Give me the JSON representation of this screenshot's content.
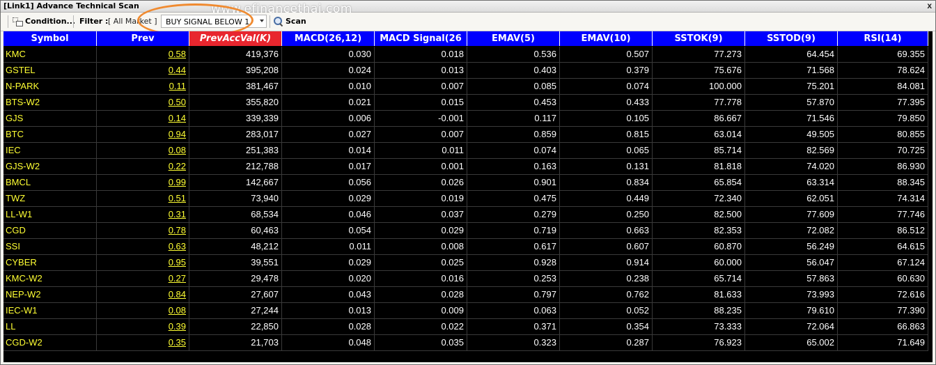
{
  "window": {
    "title": "[Link1] Advance Technical Scan",
    "close_label": "x",
    "watermark": "www.efinancethai.com"
  },
  "toolbar": {
    "condition_label": "Condition...",
    "filter_label": "Filter :",
    "filter_value": "[ All Market ]",
    "signal_selected": "BUY SIGNAL BELOW 1",
    "scan_label": "Scan",
    "highlight_color": "#f08a2f"
  },
  "table": {
    "headers": [
      "Symbol",
      "Prev",
      "PrevAccVal(K)",
      "MACD(26,12)",
      "MACD Signal(26",
      "EMAV(5)",
      "EMAV(10)",
      "SSTOK(9)",
      "SSTOD(9)",
      "RSI(14)"
    ],
    "sorted_column": 2,
    "colors": {
      "header_bg": "#0000ff",
      "sorted_header_bg": "#e8262e",
      "symbol_color": "#ffff33",
      "value_color": "#ffffff",
      "grid_bg": "#000000"
    },
    "rows": [
      [
        "KMC",
        "0.58",
        "419,376",
        "0.030",
        "0.018",
        "0.536",
        "0.507",
        "77.273",
        "64.454",
        "69.355"
      ],
      [
        "GSTEL",
        "0.44",
        "395,208",
        "0.024",
        "0.013",
        "0.403",
        "0.379",
        "75.676",
        "71.568",
        "78.624"
      ],
      [
        "N-PARK",
        "0.11",
        "381,467",
        "0.010",
        "0.007",
        "0.085",
        "0.074",
        "100.000",
        "75.201",
        "84.081"
      ],
      [
        "BTS-W2",
        "0.50",
        "355,820",
        "0.021",
        "0.015",
        "0.453",
        "0.433",
        "77.778",
        "57.870",
        "77.395"
      ],
      [
        "GJS",
        "0.14",
        "339,339",
        "0.006",
        "-0.001",
        "0.117",
        "0.105",
        "86.667",
        "71.546",
        "79.850"
      ],
      [
        "BTC",
        "0.94",
        "283,017",
        "0.027",
        "0.007",
        "0.859",
        "0.815",
        "63.014",
        "49.505",
        "80.855"
      ],
      [
        "IEC",
        "0.08",
        "251,383",
        "0.014",
        "0.011",
        "0.074",
        "0.065",
        "85.714",
        "82.569",
        "70.725"
      ],
      [
        "GJS-W2",
        "0.22",
        "212,788",
        "0.017",
        "0.001",
        "0.163",
        "0.131",
        "81.818",
        "74.020",
        "86.930"
      ],
      [
        "BMCL",
        "0.99",
        "142,667",
        "0.056",
        "0.026",
        "0.901",
        "0.834",
        "65.854",
        "63.314",
        "88.345"
      ],
      [
        "TWZ",
        "0.51",
        "73,940",
        "0.029",
        "0.019",
        "0.475",
        "0.449",
        "72.340",
        "62.051",
        "74.314"
      ],
      [
        "LL-W1",
        "0.31",
        "68,534",
        "0.046",
        "0.037",
        "0.279",
        "0.250",
        "82.500",
        "77.609",
        "77.746"
      ],
      [
        "CGD",
        "0.78",
        "60,463",
        "0.054",
        "0.029",
        "0.719",
        "0.663",
        "82.353",
        "72.082",
        "86.512"
      ],
      [
        "SSI",
        "0.63",
        "48,212",
        "0.011",
        "0.008",
        "0.617",
        "0.607",
        "60.870",
        "56.249",
        "64.615"
      ],
      [
        "CYBER",
        "0.95",
        "39,551",
        "0.029",
        "0.025",
        "0.928",
        "0.914",
        "60.000",
        "56.047",
        "67.124"
      ],
      [
        "KMC-W2",
        "0.27",
        "29,478",
        "0.020",
        "0.016",
        "0.253",
        "0.238",
        "65.714",
        "57.863",
        "60.630"
      ],
      [
        "NEP-W2",
        "0.84",
        "27,607",
        "0.043",
        "0.028",
        "0.797",
        "0.762",
        "81.633",
        "73.993",
        "72.616"
      ],
      [
        "IEC-W1",
        "0.08",
        "27,244",
        "0.013",
        "0.009",
        "0.063",
        "0.052",
        "88.235",
        "79.610",
        "77.390"
      ],
      [
        "LL",
        "0.39",
        "22,850",
        "0.028",
        "0.022",
        "0.371",
        "0.354",
        "73.333",
        "72.064",
        "66.863"
      ],
      [
        "CGD-W2",
        "0.35",
        "21,703",
        "0.048",
        "0.035",
        "0.323",
        "0.287",
        "76.923",
        "65.002",
        "71.649"
      ]
    ]
  }
}
